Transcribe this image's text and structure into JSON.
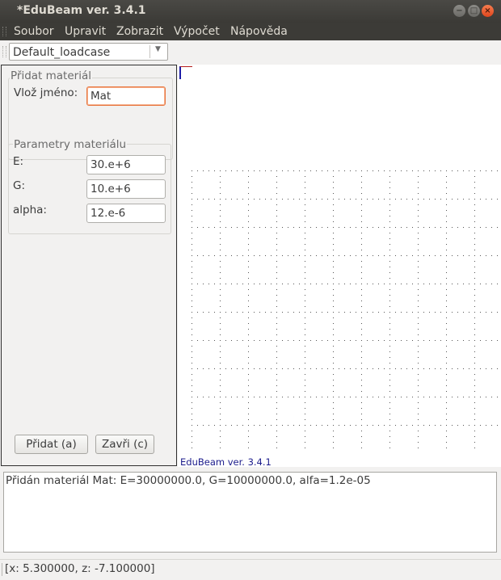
{
  "window": {
    "title": "*EduBeam ver. 3.4.1",
    "minimize_glyph": "−",
    "maximize_glyph": "□",
    "close_glyph": "×"
  },
  "menu": {
    "items": [
      "Soubor",
      "Upravit",
      "Zobrazit",
      "Výpočet",
      "Nápověda"
    ]
  },
  "toolbar": {
    "loadcase_value": "Default_loadcase",
    "dropdown_icon": "▼"
  },
  "material_panel": {
    "group_title": "Přidat materiál",
    "name_label": "Vlož jméno:",
    "name_value": "Mat",
    "params_title": "Parametry materiálu",
    "params": [
      {
        "label": "E:",
        "value": "30.e+6"
      },
      {
        "label": "G:",
        "value": "10.e+6"
      },
      {
        "label": "alpha:",
        "value": "12.e-6"
      }
    ],
    "add_button": "Přidat (a)",
    "close_button": "Zavři (c)"
  },
  "canvas": {
    "version_label": "EduBeam ver. 3.4.1"
  },
  "log": {
    "message": "Přidán materiál Mat: E=30000000.0, G=10000000.0, alfa=1.2e-05"
  },
  "status": {
    "coords": "[x: 5.300000, z: -7.100000]"
  },
  "colors": {
    "titlebar": "#3c3b37",
    "focus_border": "#e8763f",
    "canvas_label": "#1c1c8c",
    "close_button": "#e0461d"
  }
}
